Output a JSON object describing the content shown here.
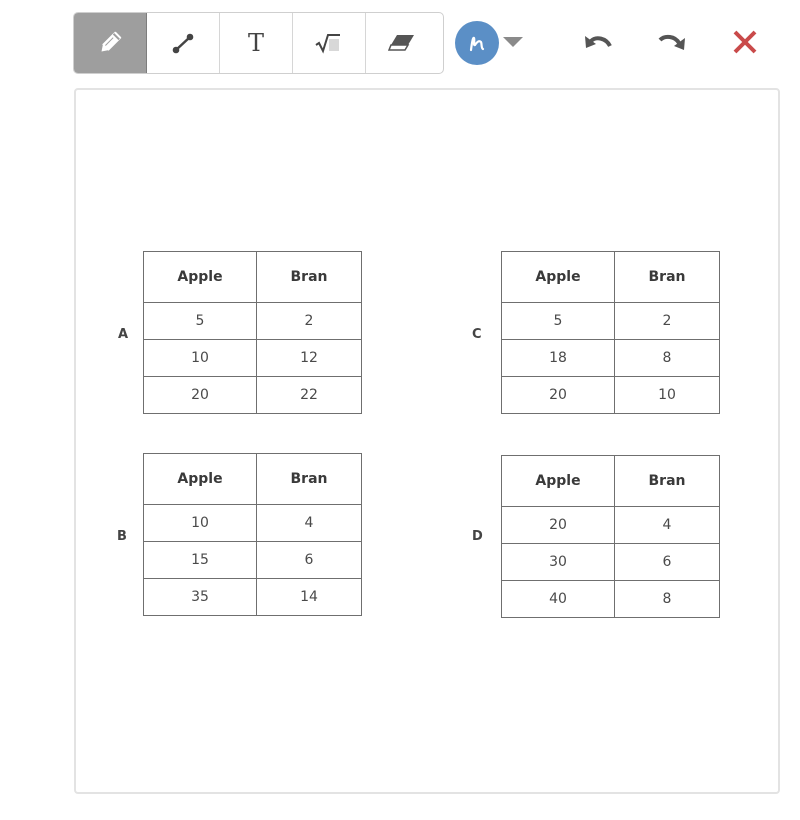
{
  "toolbar": {
    "tools": [
      {
        "name": "pencil",
        "icon": "pencil-icon",
        "active": true
      },
      {
        "name": "line",
        "icon": "line-segment-icon",
        "active": false
      },
      {
        "name": "text",
        "icon": "text-icon",
        "glyph": "T",
        "active": false
      },
      {
        "name": "math",
        "icon": "square-root-icon",
        "glyph": "√",
        "active": false
      },
      {
        "name": "eraser",
        "icon": "eraser-icon",
        "active": false
      }
    ],
    "color": {
      "icon": "pen-color-icon",
      "value": "#5b8fc6"
    },
    "undo_icon": "undo-icon",
    "redo_icon": "redo-icon",
    "close_icon": "close-icon",
    "close_color": "#c94a4a"
  },
  "options": [
    {
      "label": "A",
      "headers": [
        "Apple",
        "Bran"
      ],
      "rows": [
        [
          "5",
          "2"
        ],
        [
          "10",
          "12"
        ],
        [
          "20",
          "22"
        ]
      ]
    },
    {
      "label": "B",
      "headers": [
        "Apple",
        "Bran"
      ],
      "rows": [
        [
          "10",
          "4"
        ],
        [
          "15",
          "6"
        ],
        [
          "35",
          "14"
        ]
      ]
    },
    {
      "label": "C",
      "headers": [
        "Apple",
        "Bran"
      ],
      "rows": [
        [
          "5",
          "2"
        ],
        [
          "18",
          "8"
        ],
        [
          "20",
          "10"
        ]
      ]
    },
    {
      "label": "D",
      "headers": [
        "Apple",
        "Bran"
      ],
      "rows": [
        [
          "20",
          "4"
        ],
        [
          "30",
          "6"
        ],
        [
          "40",
          "8"
        ]
      ]
    }
  ]
}
